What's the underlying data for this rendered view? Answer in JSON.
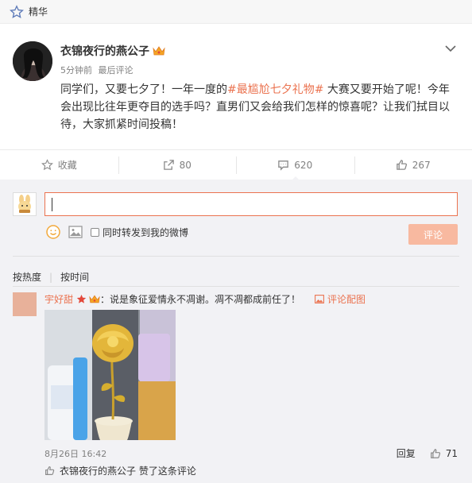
{
  "header": {
    "label": "精华",
    "icon": "star-outline-icon"
  },
  "post": {
    "author": "衣锦夜行的燕公子",
    "time": "5分钟前",
    "context": "最后评论",
    "text_before": "同学们，又要七夕了！一年一度的",
    "topic": "#最尴尬七夕礼物#",
    "text_after": " 大赛又要开始了呢！今年会出现比往年更夺目的选手吗？直男们又会给我们怎样的惊喜呢？让我们拭目以待，大家抓紧时间投稿！"
  },
  "actions": {
    "favorite": "收藏",
    "repost_count": "80",
    "comment_count": "620",
    "like_count": "267"
  },
  "composer": {
    "input_value": "",
    "repost_checkbox_label": "同时转发到我的微博",
    "submit_label": "评论"
  },
  "sort": {
    "hot": "按热度",
    "time": "按时间"
  },
  "comment": {
    "user": "宇好甜",
    "text": "：说是象征爱情永不凋谢。凋不凋都成前任了！",
    "pic_link": "评论配图",
    "date": "8月26日 16:42",
    "reply": "回复",
    "like_count": "71",
    "liked_by": "衣锦夜行的燕公子 赞了这条评论"
  },
  "colors": {
    "accent": "#eb7350",
    "submit_disabled": "#f8b9a0",
    "panel_bg": "#f2f2f5"
  }
}
